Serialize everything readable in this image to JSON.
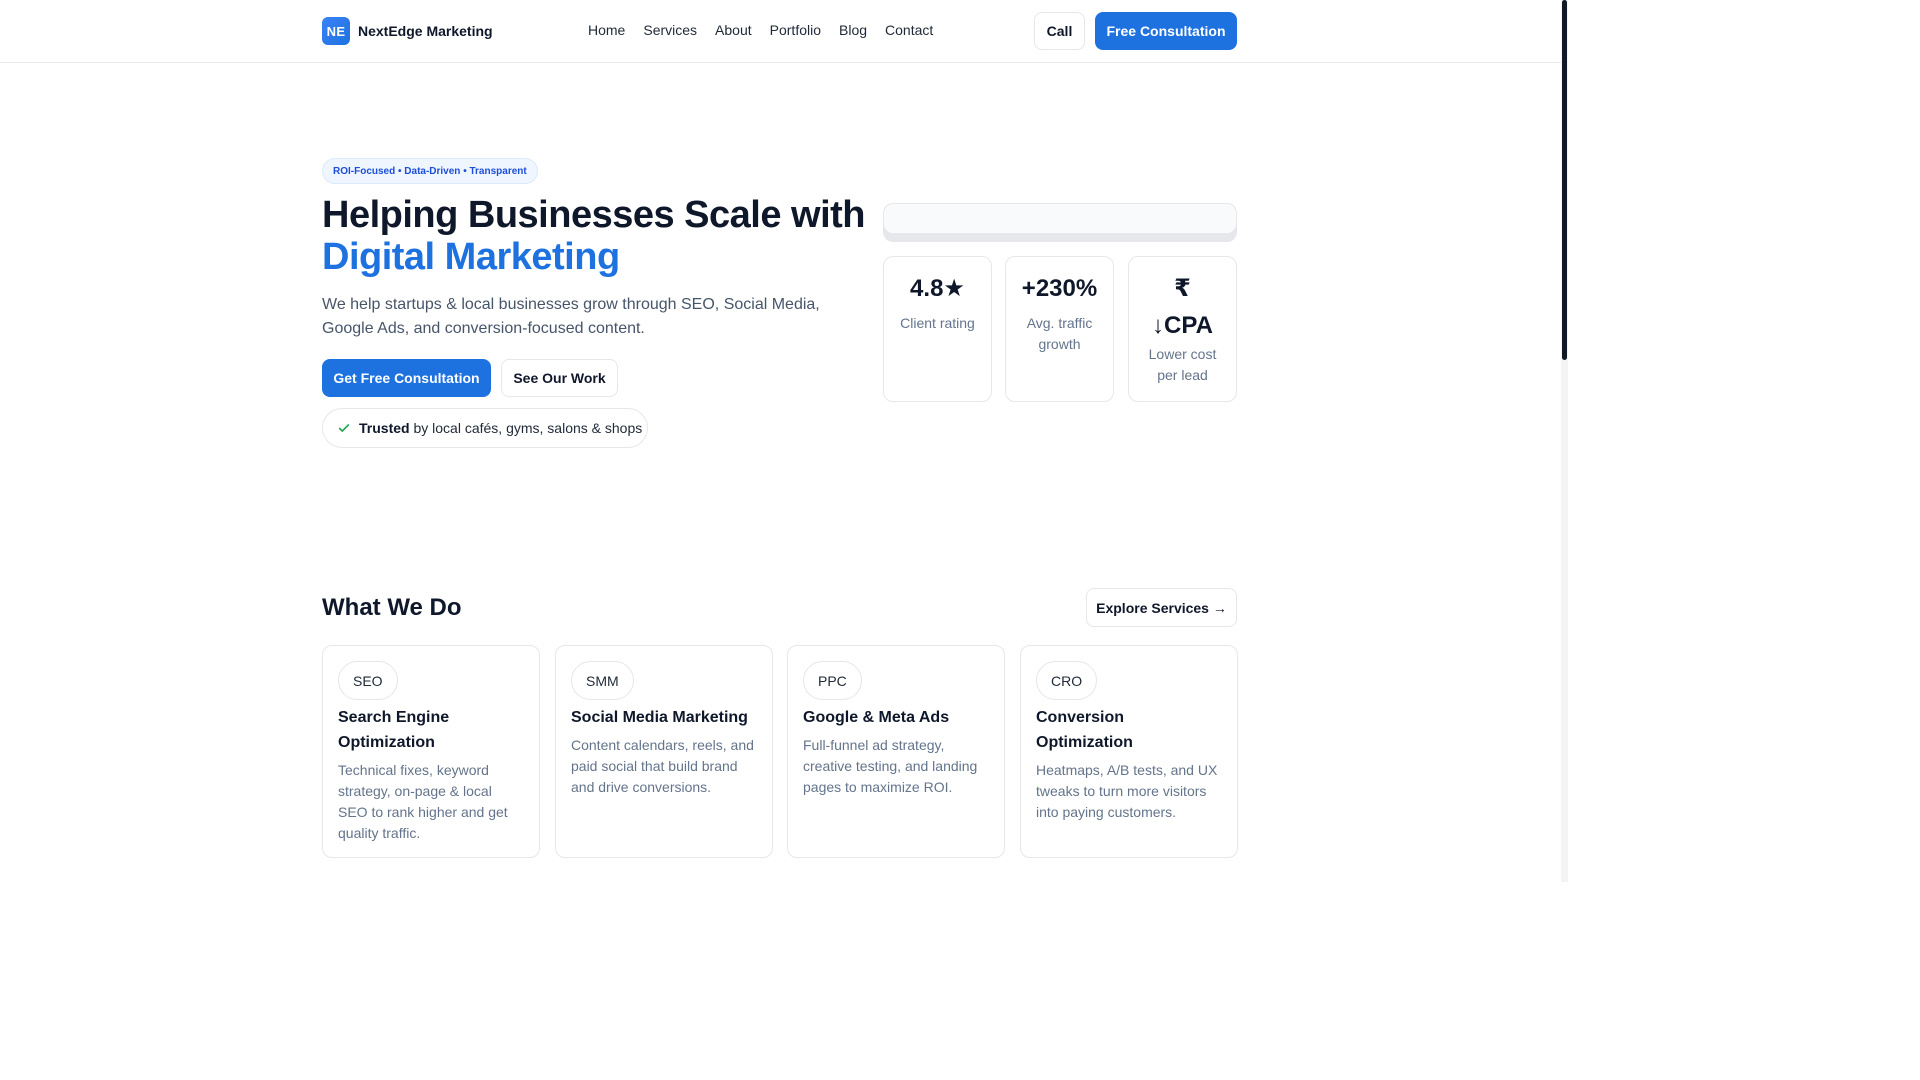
{
  "brand": {
    "badge": "NE",
    "name": "NextEdge Marketing"
  },
  "nav": [
    {
      "label": "Home"
    },
    {
      "label": "Services"
    },
    {
      "label": "About"
    },
    {
      "label": "Portfolio"
    },
    {
      "label": "Blog"
    },
    {
      "label": "Contact"
    }
  ],
  "header_actions": {
    "call_label": "Call",
    "free_label": "Free Consultation"
  },
  "hero": {
    "pill": "ROI-Focused • Data-Driven • Transparent",
    "title_line1": "Helping Businesses Scale with",
    "title_line2": "Digital Marketing",
    "subtitle": "We help startups & local businesses grow through SEO, Social Media, Google Ads, and conversion-focused content.",
    "primary_cta": "Get Free Consultation",
    "secondary_cta": "See Our Work",
    "trust_bold": "Trusted",
    "trust_rest": "by local cafés, gyms, salons & shops"
  },
  "stats": [
    {
      "value": "4.8★",
      "label": "Client rating"
    },
    {
      "value": "+230%",
      "label": "Avg. traffic growth"
    },
    {
      "value": "₹ ↓CPA",
      "label": "Lower cost per lead"
    }
  ],
  "services_section": {
    "title": "What We Do",
    "explore_label": "Explore Services →",
    "cards": [
      {
        "tag": "SEO",
        "title": "Search Engine Optimization",
        "desc": "Technical fixes, keyword strategy, on-page & local SEO to rank higher and get quality traffic."
      },
      {
        "tag": "SMM",
        "title": "Social Media Marketing",
        "desc": "Content calendars, reels, and paid social that build brand and drive conversions."
      },
      {
        "tag": "PPC",
        "title": "Google & Meta Ads",
        "desc": "Full-funnel ad strategy, creative testing, and landing pages to maximize ROI."
      },
      {
        "tag": "CRO",
        "title": "Conversion Optimization",
        "desc": "Heatmaps, A/B tests, and UX tweaks to turn more visitors into paying customers."
      }
    ]
  },
  "colors": {
    "accent": "#1d72e0",
    "text": "#0f172a",
    "muted": "#64748b",
    "border": "#e5e7eb"
  }
}
